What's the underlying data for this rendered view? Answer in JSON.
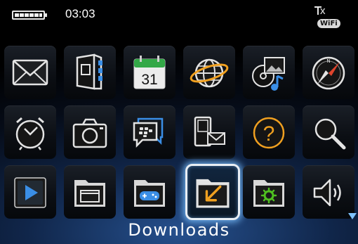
{
  "status": {
    "time": "03:03",
    "network_letter": "x",
    "wifi_badge": "WiFi",
    "battery_icon": "battery-full-icon"
  },
  "grid": {
    "selected": "Downloads",
    "rows": [
      [
        "messages-icon",
        "contacts-icon",
        "calendar-icon",
        "browser-icon",
        "media-icon",
        "compass-icon"
      ],
      [
        "clock-icon",
        "camera-icon",
        "bbm-icon",
        "sms-mms-icon",
        "help-icon",
        "search-icon"
      ],
      [
        "video-player-icon",
        "folder-icon",
        "games-folder-icon",
        "downloads-folder-icon",
        "settings-folder-icon",
        "sound-profile-icon"
      ]
    ],
    "calendar_day": "31"
  },
  "label": {
    "text": "Downloads"
  },
  "colors": {
    "accent": "#3a8ee6",
    "selection_glow": "#78beff",
    "folder": "#dcdcdc",
    "calendar_green": "#33a847",
    "settings_green": "#4fc020",
    "download_arrow": "#f0a020"
  }
}
